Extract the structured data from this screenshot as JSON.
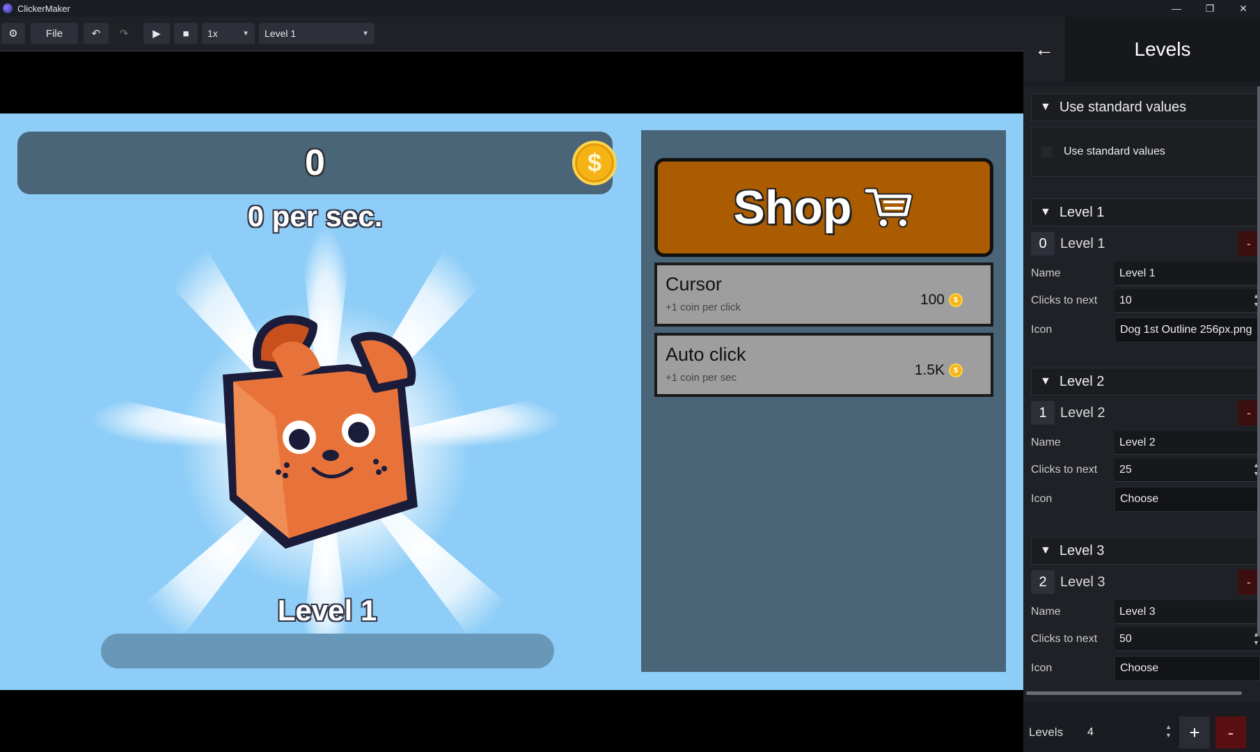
{
  "app": {
    "title": "ClickerMaker",
    "window_controls": [
      "minimize-icon",
      "restore-icon",
      "close-icon"
    ]
  },
  "toolbar": {
    "file_label": "File",
    "speed_value": "1x",
    "level_value": "Level 1",
    "icons": [
      "gear-icon",
      "undo-icon",
      "redo-icon",
      "play-icon",
      "stop-icon",
      "chevron-down-icon"
    ]
  },
  "game": {
    "coins": "0",
    "per_sec": "0 per sec.",
    "level_text": "Level 1",
    "progress": 0,
    "colors": {
      "background": "#8dcdf7",
      "panel": "#4a6478",
      "coin": "#f5b316"
    }
  },
  "shop": {
    "title": "Shop",
    "items": [
      {
        "name": "Cursor",
        "desc": "+1 coin per click",
        "price": "100"
      },
      {
        "name": "Auto click",
        "desc": "+1 coin per sec",
        "price": "1.5K"
      }
    ]
  },
  "levels_panel": {
    "title": "Levels",
    "standard_section": "Use standard values",
    "standard_checkbox_label": "Use standard values",
    "field_labels": {
      "name": "Name",
      "clicks": "Clicks to next",
      "icon": "Icon"
    },
    "levels": [
      {
        "section": "Level 1",
        "index": "0",
        "title": "Level 1",
        "name": "Level 1",
        "clicks": "10",
        "icon": "Dog 1st Outline 256px.png"
      },
      {
        "section": "Level 2",
        "index": "1",
        "title": "Level 2",
        "name": "Level 2",
        "clicks": "25",
        "icon": "Choose"
      },
      {
        "section": "Level 3",
        "index": "2",
        "title": "Level 3",
        "name": "Level 3",
        "clicks": "50",
        "icon": "Choose"
      }
    ],
    "footer": {
      "label": "Levels",
      "count": "4",
      "add": "+",
      "remove": "-"
    },
    "remove_label": "-"
  }
}
